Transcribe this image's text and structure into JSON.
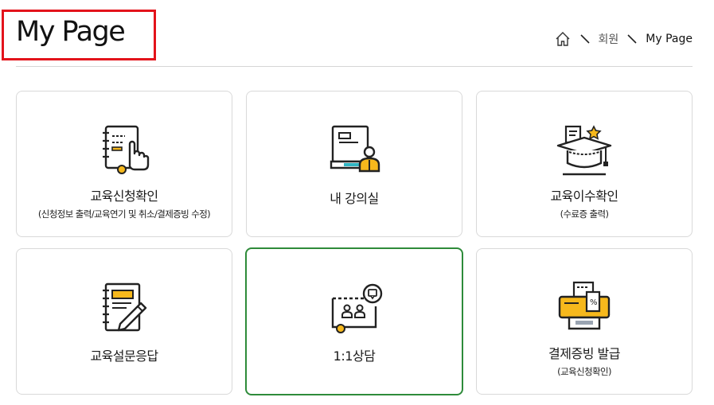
{
  "page": {
    "title": "My Page"
  },
  "breadcrumb": {
    "items": [
      "회원",
      "My Page"
    ]
  },
  "cards": [
    {
      "label": "교육신청확인",
      "sub": "(신청정보 출력/교육연기 및 취소/결제증빙 수정)",
      "icon": "planner-hand-icon"
    },
    {
      "label": "내 강의실",
      "sub": "",
      "icon": "classroom-icon"
    },
    {
      "label": "교육이수확인",
      "sub": "(수료증 출력)",
      "icon": "graduation-cap-icon"
    },
    {
      "label": "교육설문응답",
      "sub": "",
      "icon": "notebook-pencil-icon"
    },
    {
      "label": "1:1상담",
      "sub": "",
      "icon": "consultation-board-icon"
    },
    {
      "label": "결제증빙 발급",
      "sub": "(교육신청확인)",
      "icon": "receipt-printer-icon"
    }
  ],
  "colors": {
    "accent_yellow": "#f6b81c",
    "highlight_border": "#2e8b3a",
    "title_box": "#e3131b"
  }
}
